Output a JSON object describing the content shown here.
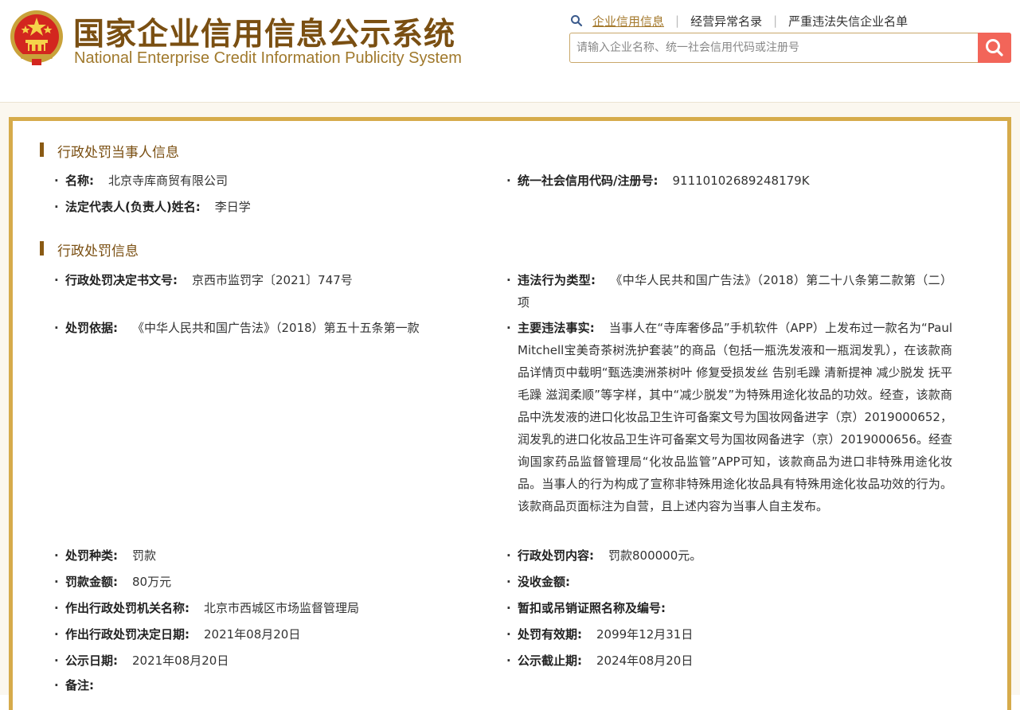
{
  "header": {
    "title_cn": "国家企业信用信息公示系统",
    "title_en": "National Enterprise Credit Information Publicity System",
    "nav": [
      "企业信用信息",
      "经营异常名录",
      "严重违法失信企业名单"
    ],
    "nav_separator": "|",
    "search_placeholder": "请输入企业名称、统一社会信用代码或注册号",
    "accent_color": "#f26559"
  },
  "section1": {
    "title": "行政处罚当事人信息",
    "name_label": "名称:",
    "name_value": "北京寺库商贸有限公司",
    "code_label": "统一社会信用代码/注册号:",
    "code_value": "91110102689248179K",
    "rep_label": "法定代表人(负责人)姓名:",
    "rep_value": "李日学"
  },
  "section2": {
    "title": "行政处罚信息",
    "doc_label": "行政处罚决定书文号:",
    "doc_value": "京西市监罚字〔2021〕747号",
    "type_label": "违法行为类型:",
    "type_value": "《中华人民共和国广告法》（2018）第二十八条第二款第（二）项",
    "basis_label": "处罚依据:",
    "basis_value": "《中华人民共和国广告法》（2018）第五十五条第一款",
    "facts_label": "主要违法事实:",
    "facts_value": "当事人在“寺库奢侈品”手机软件（APP）上发布过一款名为“Paul Mitchell宝美奇茶树洗护套装”的商品（包括一瓶洗发液和一瓶润发乳），在该款商品详情页中载明“甄选澳洲茶树叶 修复受损发丝 告别毛躁 清新提神 减少脱发 抚平毛躁 滋润柔顺”等字样，其中“减少脱发”为特殊用途化妆品的功效。经查，该款商品中洗发液的进口化妆品卫生许可备案文号为国妆网备进字（京）2019000652，润发乳的进口化妆品卫生许可备案文号为国妆网备进字（京）2019000656。经查询国家药品监督管理局“化妆品监管”APP可知，该款商品为进口非特殊用途化妆品。当事人的行为构成了宣称非特殊用途化妆品具有特殊用途化妆品功效的行为。该款商品页面标注为自营，且上述内容为当事人自主发布。",
    "kind_label": "处罚种类:",
    "kind_value": "罚款",
    "content_label": "行政处罚内容:",
    "content_value": "罚款800000元。",
    "amount_label": "罚款金额:",
    "amount_value": "80万元",
    "confiscate_label": "没收金额:",
    "confiscate_value": "",
    "authority_label": "作出行政处罚机关名称:",
    "authority_value": "北京市西城区市场监督管理局",
    "license_label": "暂扣或吊销证照名称及编号:",
    "license_value": "",
    "decision_date_label": "作出行政处罚决定日期:",
    "decision_date_value": "2021年08月20日",
    "valid_label": "处罚有效期:",
    "valid_value": "2099年12月31日",
    "publish_label": "公示日期:",
    "publish_value": "2021年08月20日",
    "deadline_label": "公示截止期:",
    "deadline_value": "2024年08月20日",
    "remark_label": "备注:",
    "remark_value": ""
  }
}
